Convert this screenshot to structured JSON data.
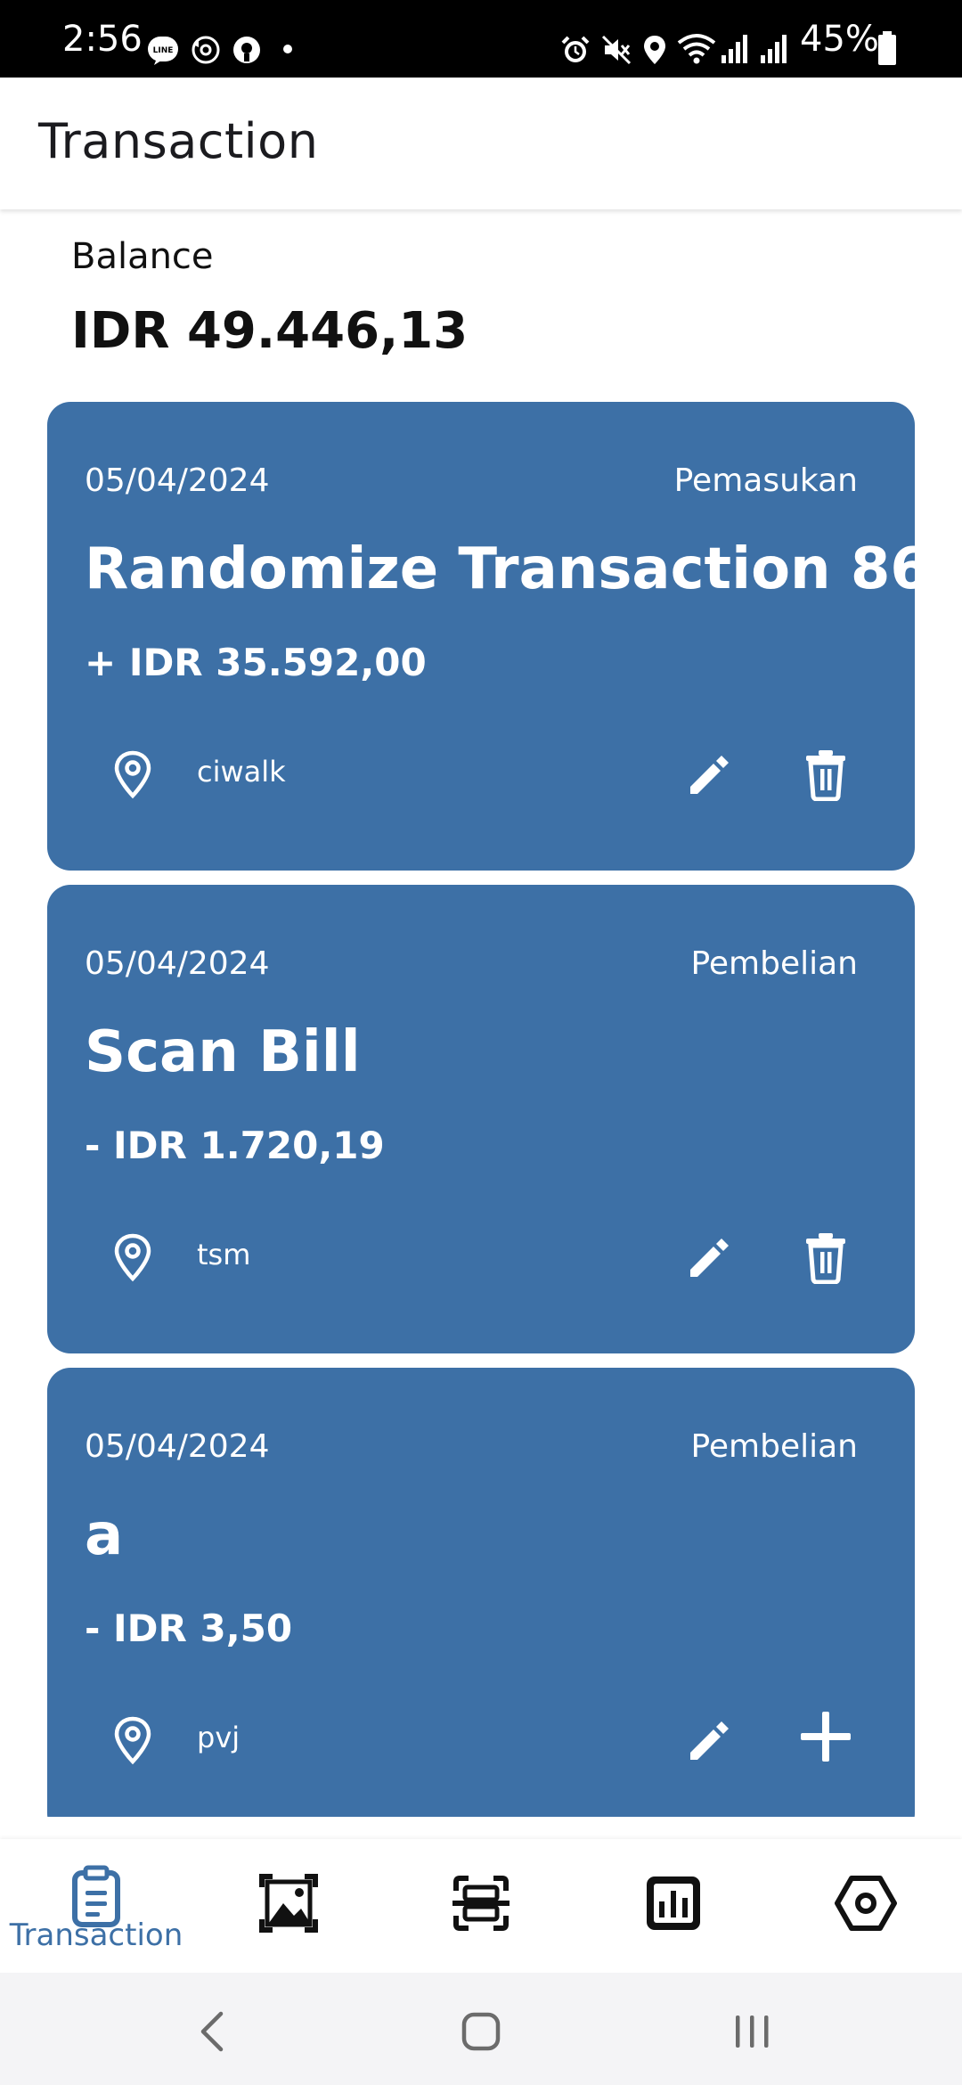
{
  "status_bar": {
    "time": "2:56",
    "battery": "45%",
    "left_icons": [
      "line-app-icon",
      "sync-icon",
      "circle-notification-icon"
    ],
    "right_icons": [
      "alarm-icon",
      "mute-icon",
      "location-icon",
      "wifi-icon",
      "signal-icon",
      "signal-icon",
      "battery-icon"
    ]
  },
  "app_bar": {
    "title": "Transaction"
  },
  "balance": {
    "label": "Balance",
    "value": "IDR 49.446,13"
  },
  "transactions": [
    {
      "date": "05/04/2024",
      "type": "Pemasukan",
      "title": "Randomize Transaction 86",
      "amount": "+ IDR 35.592,00",
      "location": "ciwalk"
    },
    {
      "date": "05/04/2024",
      "type": "Pembelian",
      "title": "Scan Bill",
      "amount": "- IDR 1.720,19",
      "location": "tsm"
    },
    {
      "date": "05/04/2024",
      "type": "Pembelian",
      "title": "a",
      "amount": "- IDR 3,50",
      "location": "pvj"
    }
  ],
  "bottom_nav": {
    "items": [
      {
        "icon": "clipboard-icon",
        "label": "Transaction",
        "active": true
      },
      {
        "icon": "gallery-icon",
        "active": false
      },
      {
        "icon": "scan-icon",
        "active": false
      },
      {
        "icon": "chart-icon",
        "active": false
      },
      {
        "icon": "settings-icon",
        "active": false
      }
    ]
  },
  "colors": {
    "card": "#3d70a6",
    "accent": "#3d70a6",
    "nav_icon": "#111111"
  }
}
